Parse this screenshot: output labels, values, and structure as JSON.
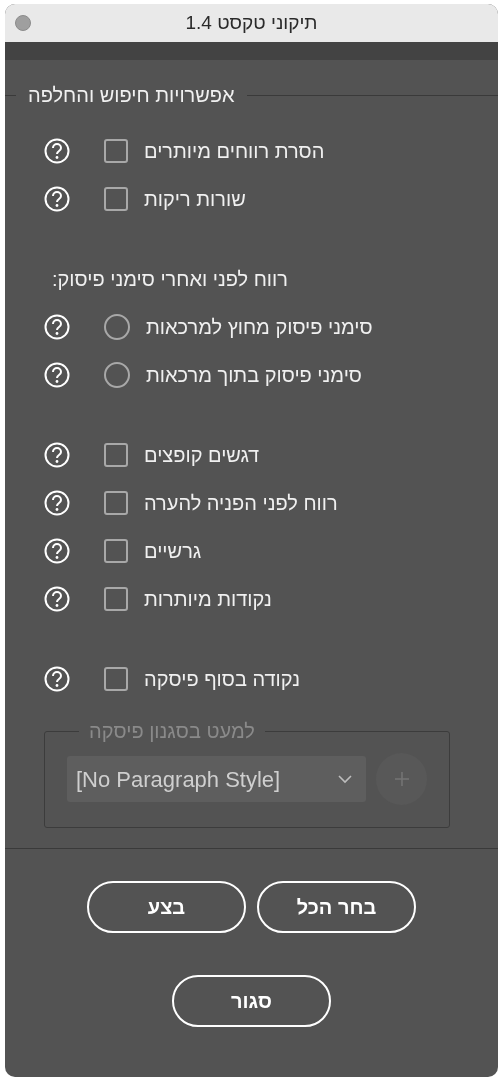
{
  "window": {
    "title": "תיקוני טקסט 1.4"
  },
  "options_group": {
    "legend": "אפשרויות חיפוש והחלפה",
    "sections": [
      {
        "items": [
          {
            "kind": "checkbox",
            "label": "הסרת רווחים מיותרים",
            "checked": false
          },
          {
            "kind": "checkbox",
            "label": "שורות ריקות",
            "checked": false
          }
        ]
      },
      {
        "heading": "רווח לפני ואחרי סימני פיסוק:",
        "items": [
          {
            "kind": "radio",
            "label": "סימני פיסוק מחוץ למרכאות",
            "selected": false
          },
          {
            "kind": "radio",
            "label": "סימני פיסוק בתוך מרכאות",
            "selected": false
          }
        ]
      },
      {
        "items": [
          {
            "kind": "checkbox",
            "label": "דגשים קופצים",
            "checked": false
          },
          {
            "kind": "checkbox",
            "label": "רווח לפני הפניה להערה",
            "checked": false
          },
          {
            "kind": "checkbox",
            "label": "גרשיים",
            "checked": false
          },
          {
            "kind": "checkbox",
            "label": "נקודות מיותרות",
            "checked": false
          }
        ]
      },
      {
        "items": [
          {
            "kind": "checkbox",
            "label": "נקודה בסוף פיסקה",
            "checked": false
          }
        ]
      }
    ],
    "exclude_group": {
      "legend": "למעט בסגנון פיסקה",
      "disabled": true,
      "dropdown": {
        "value": "[No Paragraph Style]"
      }
    }
  },
  "buttons": [
    {
      "label": "בצע"
    },
    {
      "label": "בחר הכל"
    },
    {
      "label": "סגור"
    }
  ]
}
